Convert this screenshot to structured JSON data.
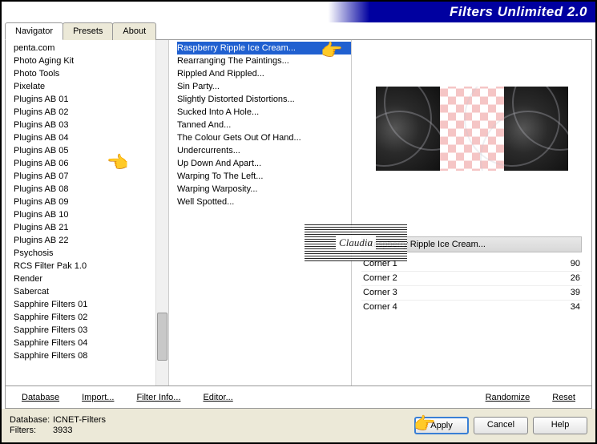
{
  "header": {
    "title": "Filters Unlimited 2.0"
  },
  "tabs": [
    {
      "label": "Navigator",
      "active": true
    },
    {
      "label": "Presets",
      "active": false
    },
    {
      "label": "About",
      "active": false
    }
  ],
  "categories": [
    "penta.com",
    "Photo Aging Kit",
    "Photo Tools",
    "Pixelate",
    "Plugins AB 01",
    "Plugins AB 02",
    "Plugins AB 03",
    "Plugins AB 04",
    "Plugins AB 05",
    "Plugins AB 06",
    "Plugins AB 07",
    "Plugins AB 08",
    "Plugins AB 09",
    "Plugins AB 10",
    "Plugins AB 21",
    "Plugins AB 22",
    "Psychosis",
    "RCS Filter Pak 1.0",
    "Render",
    "Sabercat",
    "Sapphire Filters 01",
    "Sapphire Filters 02",
    "Sapphire Filters 03",
    "Sapphire Filters 04",
    "Sapphire Filters 08"
  ],
  "filters": [
    "Raspberry Ripple Ice Cream...",
    "Rearranging The Paintings...",
    "Rippled And Rippled...",
    "Sin Party...",
    "Slightly Distorted Distortions...",
    "Sucked Into A Hole...",
    "Tanned And...",
    "The Colour Gets Out Of Hand...",
    "Undercurrents...",
    "Up Down And Apart...",
    "Warping To The Left...",
    "Warping Warposity...",
    "Well Spotted..."
  ],
  "selected_filter_index": 0,
  "current_filter_name": "Raspberry Ripple Ice Cream...",
  "params": [
    {
      "name": "Corner 1",
      "value": "90"
    },
    {
      "name": "Corner 2",
      "value": "26"
    },
    {
      "name": "Corner 3",
      "value": "39"
    },
    {
      "name": "Corner 4",
      "value": "34"
    }
  ],
  "bottom_bar": {
    "database": "Database",
    "import": "Import...",
    "filter_info": "Filter Info...",
    "editor": "Editor...",
    "randomize": "Randomize",
    "reset": "Reset"
  },
  "footer": {
    "db_label": "Database:",
    "db_value": "ICNET-Filters",
    "filters_label": "Filters:",
    "filters_value": "3933",
    "apply": "Apply",
    "cancel": "Cancel",
    "help": "Help"
  },
  "watermark": "Claudia"
}
